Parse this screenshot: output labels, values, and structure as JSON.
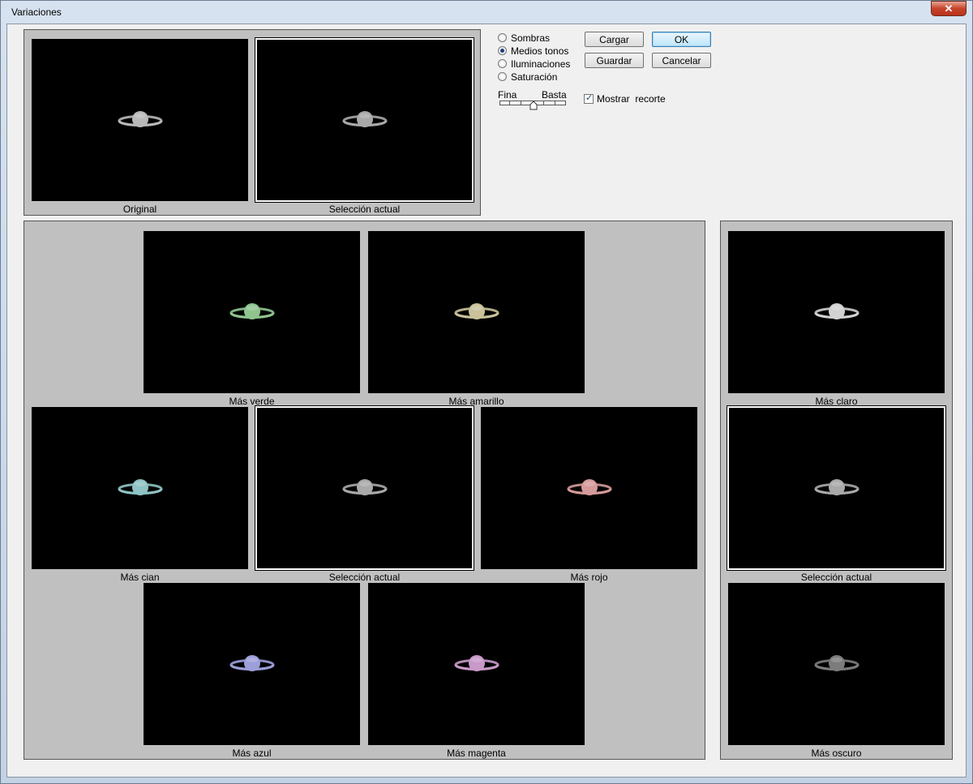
{
  "window": {
    "title": "Variaciones",
    "close_glyph": "✕"
  },
  "options": {
    "radios": [
      {
        "label": "Sombras",
        "selected": false
      },
      {
        "label": "Medios tonos",
        "selected": true
      },
      {
        "label": "Iluminaciones",
        "selected": false
      },
      {
        "label": "Saturación",
        "selected": false
      }
    ],
    "slider": {
      "min_label": "Fina",
      "max_label": "Basta",
      "value_fraction": 0.5
    },
    "show_clipping": {
      "label": "Mostrar  recorte",
      "checked": true
    }
  },
  "buttons": {
    "load": "Cargar",
    "ok": "OK",
    "save": "Guardar",
    "cancel": "Cancelar"
  },
  "top": {
    "original": "Original",
    "current": "Selección actual"
  },
  "colors": {
    "original": "#b9b9b9",
    "current": "#a9a9a9",
    "more_green": "#8fc48f",
    "more_yellow": "#c9c29a",
    "more_cyan": "#8fc3c4",
    "more_red": "#d69a9a",
    "more_blue": "#9c9fd9",
    "more_magenta": "#c899c9",
    "lighter": "#d2d2d2",
    "darker": "#7c7c7c"
  },
  "variations": {
    "more_green": "Más verde",
    "more_yellow": "Más amarillo",
    "more_cyan": "Más cian",
    "current": "Selección actual",
    "more_red": "Más rojo",
    "more_blue": "Más azul",
    "more_magenta": "Más magenta"
  },
  "brightness": {
    "lighter": "Más claro",
    "current": "Selección actual",
    "darker": "Más oscuro"
  }
}
